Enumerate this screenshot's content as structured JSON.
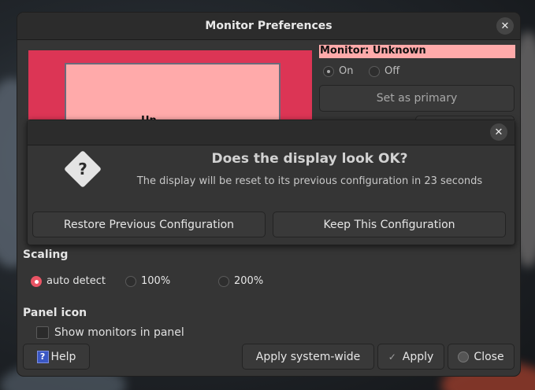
{
  "window": {
    "title": "Monitor Preferences"
  },
  "preview": {
    "label": "Un"
  },
  "monitor": {
    "header": "Monitor: Unknown",
    "on_label": "On",
    "off_label": "Off",
    "set_primary_label": "Set as primary"
  },
  "dialog": {
    "title": "Does the display look OK?",
    "message": "The display will be reset to its previous configuration in 23 seconds",
    "restore_label": "Restore Previous Configuration",
    "keep_label": "Keep This Configuration"
  },
  "scaling": {
    "label": "Scaling",
    "options": [
      "auto detect",
      "100%",
      "200%"
    ],
    "selected": "auto detect"
  },
  "panel_icon": {
    "label": "Panel icon",
    "show_monitors_label": "Show monitors in panel"
  },
  "footer": {
    "help_label": "Help",
    "apply_system_wide_label": "Apply system-wide",
    "apply_label": "Apply",
    "close_label": "Close"
  },
  "colors": {
    "accent_red": "#e95464",
    "preview_bg": "#dc3555",
    "monitor_fill": "#ffaaaa"
  }
}
